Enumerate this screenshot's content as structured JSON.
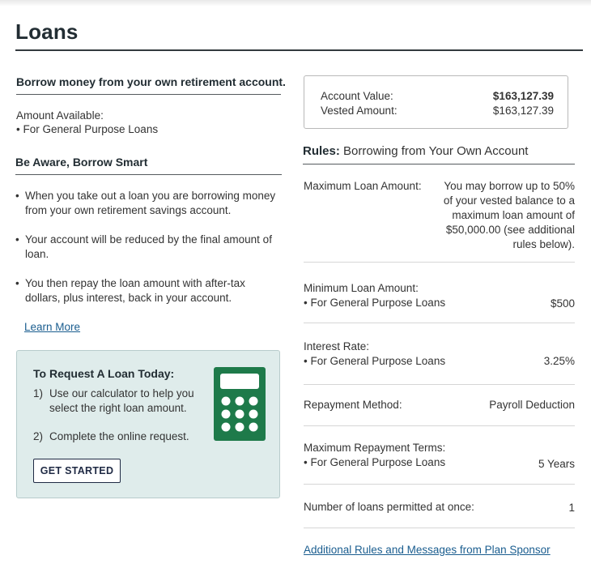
{
  "page": {
    "title": "Loans"
  },
  "left": {
    "borrow_heading": "Borrow money from your own retirement account.",
    "amount_available_label": "Amount Available:",
    "amount_available_item": "• For General Purpose Loans",
    "aware_heading": "Be Aware, Borrow Smart",
    "bullets": [
      "When you take out a loan you are borrowing money from your own retirement savings account.",
      "Your account will be reduced by the final amount of loan.",
      "You then repay the loan amount with after-tax dollars, plus interest, back in your account."
    ],
    "learn_more": "Learn More"
  },
  "callout": {
    "title": "To Request A Loan Today:",
    "steps": [
      {
        "num": "1)",
        "text": "Use our calculator to help you select the right loan amount."
      },
      {
        "num": "2)",
        "text": "Complete the online request."
      }
    ],
    "button": "GET STARTED",
    "icon": "calculator-icon",
    "icon_color": "#1e7a4a"
  },
  "account": {
    "value_label": "Account Value:",
    "value": "$163,127.39",
    "vested_label": "Vested Amount:",
    "vested": "$163,127.39"
  },
  "rules": {
    "heading_bold": "Rules:",
    "heading_text": " Borrowing from Your Own Account",
    "max_loan_label": "Maximum Loan Amount:",
    "max_loan_value": "You may borrow up to 50% of your vested balance to a maximum loan amount of $50,000.00 (see additional rules below).",
    "min_loan_label": "Minimum Loan Amount:",
    "min_loan_item": "• For General Purpose Loans",
    "min_loan_value": "$500",
    "interest_label": "Interest Rate:",
    "interest_item": "• For General Purpose Loans",
    "interest_value": "3.25%",
    "repayment_label": "Repayment Method:",
    "repayment_value": "Payroll Deduction",
    "max_terms_label": "Maximum Repayment Terms:",
    "max_terms_item": "• For General Purpose Loans",
    "max_terms_value": "5 Years",
    "num_loans_label": "Number of loans permitted at once:",
    "num_loans_value": "1",
    "additional_link": "Additional Rules and Messages from Plan Sponsor"
  }
}
